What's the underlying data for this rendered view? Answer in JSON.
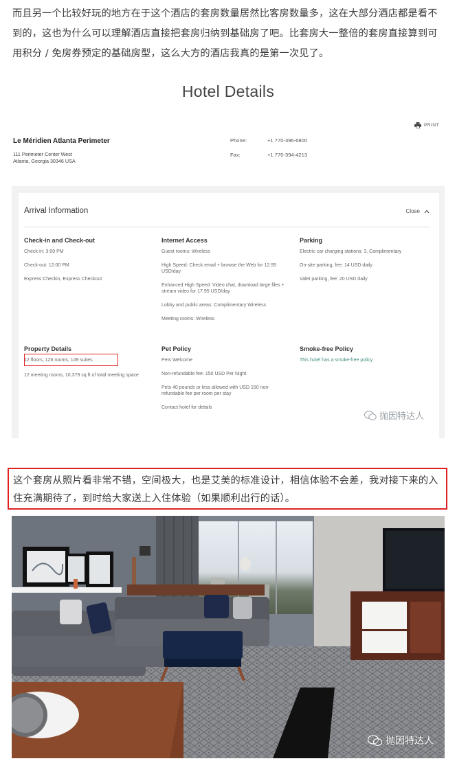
{
  "intro_text": "而且另一个比较好玩的地方在于这个酒店的套房数量居然比客房数量多，这在大部分酒店都是看不到的，这也为什么可以理解酒店直接把套房归纳到基础房了吧。比套房大一整倍的套房直接算到可用积分 / 免房券预定的基础房型，这么大方的酒店我真的是第一次见了。",
  "hotel": {
    "title": "Hotel Details",
    "print_label": "PRINT",
    "name": "Le Méridien Atlanta Perimeter",
    "address_line1": "111 Perimeter Center West",
    "address_line2": "Atlanta, Georgia 30346 USA",
    "phone_label": "Phone:",
    "phone": "+1 770-396-6800",
    "fax_label": "Fax:",
    "fax": "+1 770-394-4213"
  },
  "arrival": {
    "title": "Arrival Information",
    "close_label": "Close",
    "sections": {
      "checkin": {
        "heading": "Check-in and Check-out",
        "items": [
          "Check-in: 3:00 PM",
          "Check-out: 12:00 PM",
          "Express Checkin, Express Checkout"
        ]
      },
      "internet": {
        "heading": "Internet Access",
        "items": [
          "Guest rooms: Wireless",
          "High Speed: Check email + browse the Web for 12.95 USD/day",
          "Enhanced High Speed: Video chat, download large files + stream video for 17.95 USD/day",
          "Lobby and public areas: Complimentary Wireless",
          "Meeting rooms: Wireless"
        ]
      },
      "parking": {
        "heading": "Parking",
        "items": [
          "Electric car charging stations: 3, Complimentary",
          "On-site parking, fee: 14 USD daily",
          "Valet parking, fee: 20 USD daily"
        ]
      },
      "property": {
        "heading": "Property Details",
        "items": [
          "12 floors, 126 rooms, 149 suites",
          "12 meeting rooms, 10,379 sq ft of total meeting space"
        ]
      },
      "pet": {
        "heading": "Pet Policy",
        "items": [
          "Pets Welcome",
          "Non-refundable fee: 150 USD Per Night",
          "Pets 40 pounds or less allowed with USD 150 non-refundable fee per room per stay",
          "Contact hotel for details"
        ]
      },
      "smoke": {
        "heading": "Smoke-free Policy",
        "items": [
          "This hotel has a smoke-free policy"
        ]
      }
    }
  },
  "watermark": "抛因特达人",
  "quote_text": "这个套房从照片看非常不错，空间极大，也是艾美的标准设计，相信体验不会差，我对接下来的入住充满期待了，到时给大家送上入住体验（如果顺利出行的话）。",
  "colors": {
    "highlight_red": "#e02020",
    "link_green": "#3f8a7e"
  }
}
